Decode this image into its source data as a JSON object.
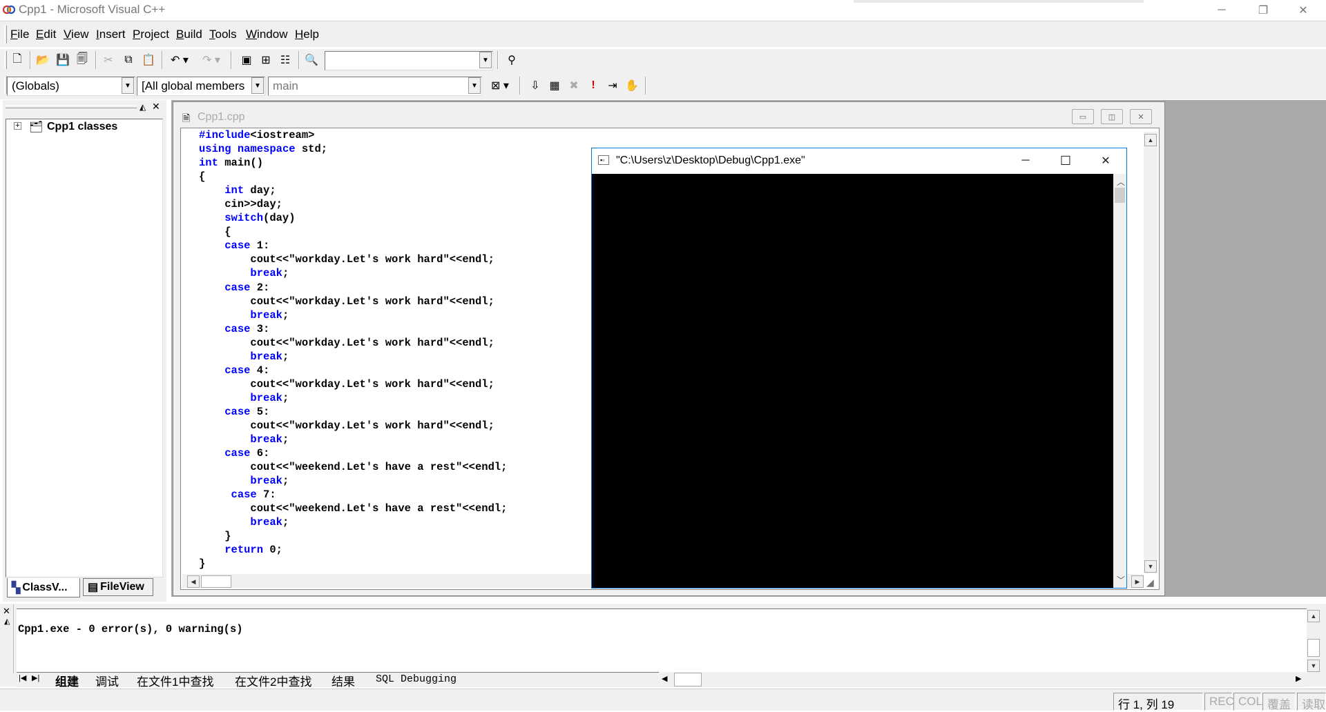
{
  "window": {
    "title": "Cpp1 - Microsoft Visual C++",
    "min": "─",
    "restore": "❐",
    "close": "✕"
  },
  "menu": [
    {
      "u": "F",
      "rest": "ile"
    },
    {
      "u": "E",
      "rest": "dit"
    },
    {
      "u": "V",
      "rest": "iew"
    },
    {
      "u": "I",
      "rest": "nsert"
    },
    {
      "u": "P",
      "rest": "roject"
    },
    {
      "u": "B",
      "rest": "uild"
    },
    {
      "u": "T",
      "rest": "ools"
    },
    {
      "u": "W",
      "rest": "indow"
    },
    {
      "u": "H",
      "rest": "elp"
    }
  ],
  "toolbar": {
    "find_combo_value": ""
  },
  "wizardbar": {
    "class_combo": "(Globals)",
    "filter_combo": "[All global members",
    "member_combo": "main"
  },
  "classview": {
    "root_label": "Cpp1 classes",
    "expander": "+",
    "tab_classview": "ClassV...",
    "tab_fileview": "FileView"
  },
  "editor": {
    "doc_title": "Cpp1.cpp",
    "lines": [
      [
        "#include<iostream>"
      ],
      [
        "using namespace std;"
      ],
      [
        "int main()"
      ],
      [
        "{"
      ],
      [
        "    int day;"
      ],
      [
        "    cin>>day;"
      ],
      [
        "    switch(day)"
      ],
      [
        "    {"
      ],
      [
        "    case 1:"
      ],
      [
        "        cout<<\"workday.Let's work hard\"<<endl;"
      ],
      [
        "        break;"
      ],
      [
        "    case 2:"
      ],
      [
        "        cout<<\"workday.Let's work hard\"<<endl;"
      ],
      [
        "        break;"
      ],
      [
        "    case 3:"
      ],
      [
        "        cout<<\"workday.Let's work hard\"<<endl;"
      ],
      [
        "        break;"
      ],
      [
        "    case 4:"
      ],
      [
        "        cout<<\"workday.Let's work hard\"<<endl;"
      ],
      [
        "        break;"
      ],
      [
        "    case 5:"
      ],
      [
        "        cout<<\"workday.Let's work hard\"<<endl;"
      ],
      [
        "        break;"
      ],
      [
        "    case 6:"
      ],
      [
        "        cout<<\"weekend.Let's have a rest\"<<endl;"
      ],
      [
        "        break;"
      ],
      [
        "     case 7:"
      ],
      [
        "        cout<<\"weekend.Let's have a rest\"<<endl;"
      ],
      [
        "        break;"
      ],
      [
        "    }"
      ],
      [
        "    return 0;"
      ],
      [
        "}"
      ]
    ]
  },
  "console": {
    "title": "\"C:\\Users\\z\\Desktop\\Debug\\Cpp1.exe\"",
    "min": "─",
    "max": "☐",
    "close": "✕"
  },
  "output": {
    "text": "Cpp1.exe - 0 error(s), 0 warning(s)",
    "tabs": [
      "组建",
      "调试",
      "在文件1中查找",
      "在文件2中查找",
      "结果",
      "SQL Debugging"
    ]
  },
  "status": {
    "position": "行 1, 列 19",
    "rec": "REC",
    "col": "COL",
    "ovr": "覆盖",
    "read": "读取"
  }
}
